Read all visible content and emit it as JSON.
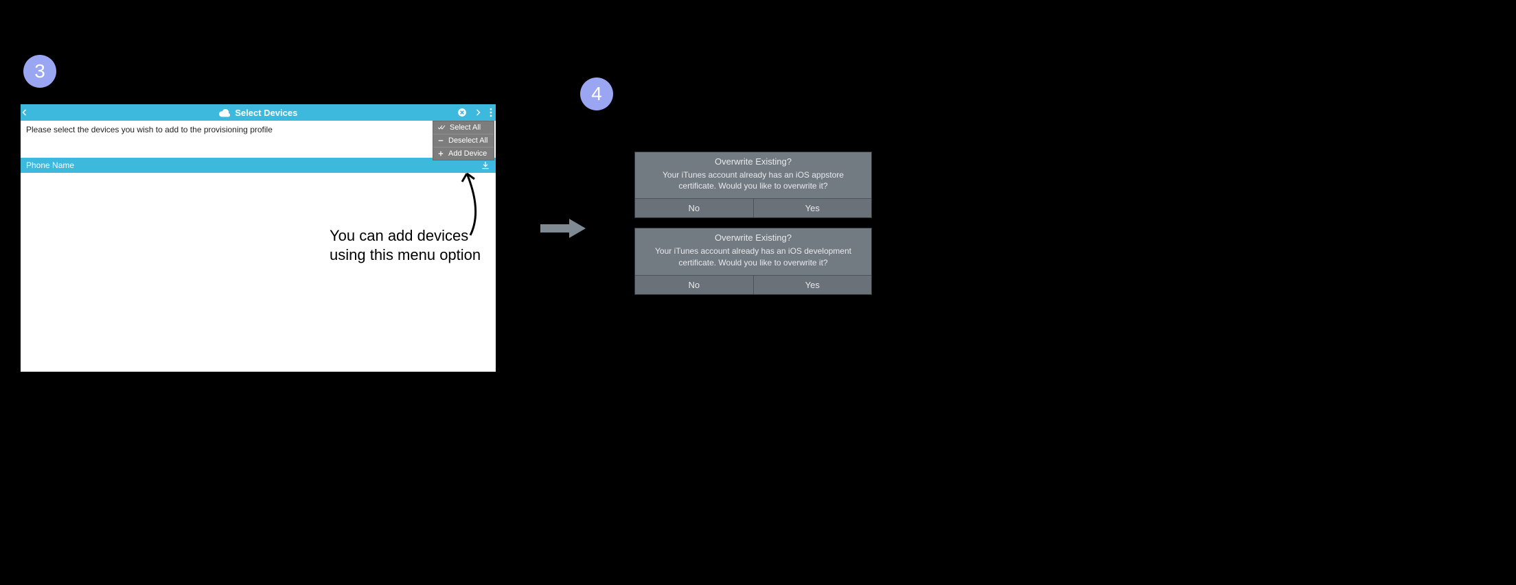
{
  "steps": {
    "three": "3",
    "four": "4"
  },
  "panel3": {
    "title": "Select Devices",
    "instruction": "Please select the devices you wish to add to the provisioning profile",
    "row_header": "Phone Name",
    "menu": {
      "select_all": "Select All",
      "deselect_all": "Deselect All",
      "add_device": "Add Device"
    }
  },
  "annotation3": "You can add devices using this menu option",
  "dialogs": [
    {
      "title": "Overwrite Existing?",
      "body": "Your iTunes account already has an iOS appstore certificate.  Would you like to overwrite it?",
      "no": "No",
      "yes": "Yes"
    },
    {
      "title": "Overwrite Existing?",
      "body": "Your iTunes account already has an iOS development certificate.  Would you like to overwrite it?",
      "no": "No",
      "yes": "Yes"
    }
  ]
}
